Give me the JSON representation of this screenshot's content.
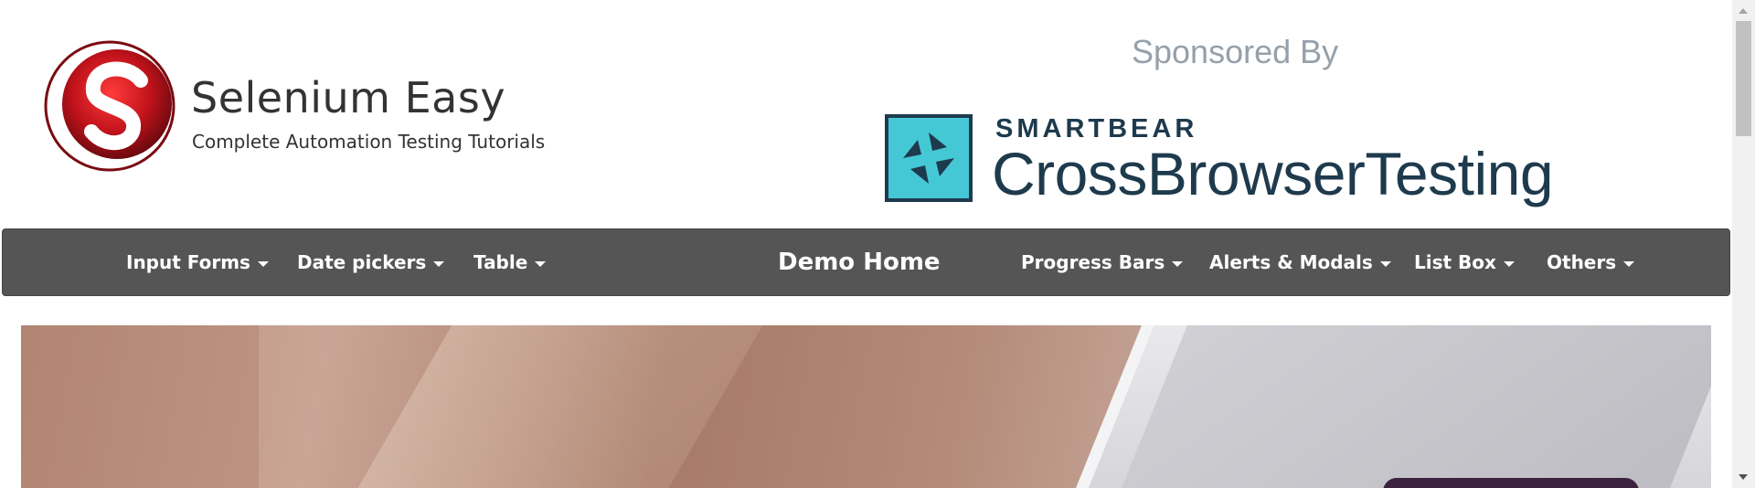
{
  "header": {
    "brand_title": "Selenium Easy",
    "brand_subtitle": "Complete Automation Testing Tutorials",
    "sponsor_label": "Sponsored By",
    "sponsor_brand": "SMARTBEAR",
    "sponsor_product": "CrossBrowserTesting"
  },
  "nav": {
    "home": "Demo Home",
    "left_items": [
      "Input Forms",
      "Date pickers",
      "Table"
    ],
    "right_items": [
      "Progress Bars",
      "Alerts & Modals",
      "List Box",
      "Others"
    ]
  },
  "colors": {
    "navbar": "#555555",
    "logo_red": "#c0121b",
    "sponsor_teal": "#45c8d6",
    "sponsor_navy": "#1e3a4d"
  },
  "icons": {
    "logo": "selenium-easy-logo-icon",
    "sponsor": "crossbrowsertesting-logo-icon",
    "caret": "caret-down-icon"
  }
}
